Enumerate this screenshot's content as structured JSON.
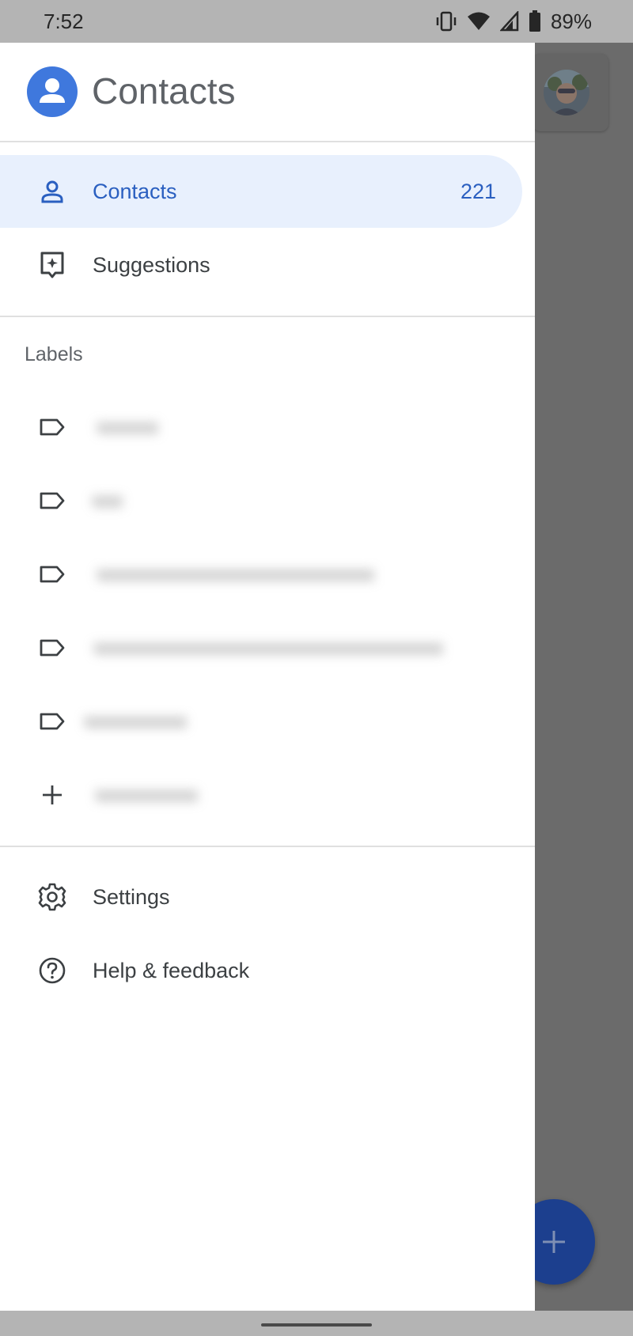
{
  "status_bar": {
    "time": "7:52",
    "battery_percent": "89%",
    "icons": [
      "vibrate-icon",
      "wifi-icon",
      "signal-icon",
      "battery-icon"
    ]
  },
  "drawer": {
    "app_title": "Contacts",
    "nav": {
      "contacts_label": "Contacts",
      "contacts_count": "221",
      "suggestions_label": "Suggestions"
    },
    "labels_section_title": "Labels",
    "labels": [
      {
        "text": "xxxxxx",
        "icon": "label-icon"
      },
      {
        "text": "xxx",
        "icon": "label-icon"
      },
      {
        "text": "xxxxxxxxxxxxxxxxxxxxxxxxxxx",
        "icon": "label-icon"
      },
      {
        "text": "xxxxxxxxxxxxxxxxxxxxxxxxxxxxxxxxxx",
        "icon": "label-icon"
      },
      {
        "text": "xxxxxxxxxx",
        "icon": "label-icon"
      },
      {
        "text": "xxxxxxxxxx",
        "icon": "add-icon"
      }
    ],
    "settings_label": "Settings",
    "help_label": "Help & feedback"
  },
  "colors": {
    "accent": "#3f78dd",
    "selected_bg": "#e8f0fd",
    "selected_text": "#2a5fc0",
    "fab": "#1c3f8e",
    "scrim": "#6b6b6b"
  }
}
